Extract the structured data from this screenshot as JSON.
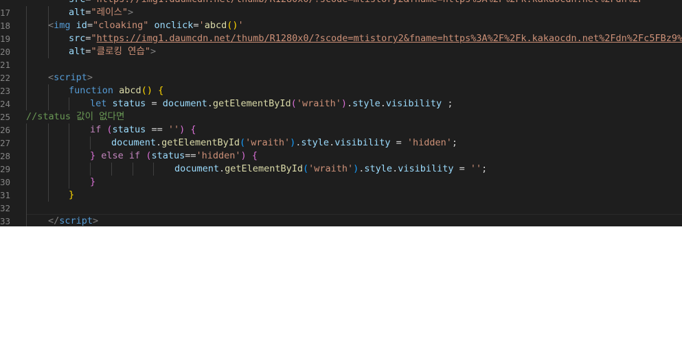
{
  "editor": {
    "lines": [
      {
        "n": "17",
        "parts": [
          {
            "c": "t-attr",
            "t": "alt"
          },
          {
            "c": "t-plain",
            "t": "="
          },
          {
            "c": "t-str",
            "t": "\"레이스\""
          },
          {
            "c": "t-tag",
            "t": ">"
          }
        ]
      },
      {
        "n": "18",
        "parts": [
          {
            "c": "t-tag",
            "t": "<"
          },
          {
            "c": "t-tagname",
            "t": "img"
          },
          {
            "c": "t-plain",
            "t": " "
          },
          {
            "c": "t-attr",
            "t": "id"
          },
          {
            "c": "t-plain",
            "t": "="
          },
          {
            "c": "t-str",
            "t": "\"cloaking\""
          },
          {
            "c": "t-plain",
            "t": " "
          },
          {
            "c": "t-attr",
            "t": "onclick"
          },
          {
            "c": "t-plain",
            "t": "="
          },
          {
            "c": "t-str",
            "t": "'"
          },
          {
            "c": "t-fn",
            "t": "abcd"
          },
          {
            "c": "t-brk1",
            "t": "()"
          },
          {
            "c": "t-str",
            "t": "'"
          }
        ]
      },
      {
        "n": "19",
        "parts": [
          {
            "c": "t-attr",
            "t": "src"
          },
          {
            "c": "t-plain",
            "t": "="
          },
          {
            "c": "t-str",
            "t": "\""
          },
          {
            "c": "t-link",
            "t": "https://img1.daumcdn.net/thumb/R1280x0/?scode=mtistory2&fname=https%3A%2F%2Fk.kakaocdn.net%2Fdn%2Fc5FBz9%2FbtrI"
          }
        ]
      },
      {
        "n": "20",
        "parts": [
          {
            "c": "t-attr",
            "t": "alt"
          },
          {
            "c": "t-plain",
            "t": "="
          },
          {
            "c": "t-str",
            "t": "\"클로킹 연습\""
          },
          {
            "c": "t-tag",
            "t": ">"
          }
        ]
      },
      {
        "n": "21",
        "parts": []
      },
      {
        "n": "22",
        "parts": [
          {
            "c": "t-tag",
            "t": "<"
          },
          {
            "c": "t-tagname",
            "t": "script"
          },
          {
            "c": "t-tag",
            "t": ">"
          }
        ]
      },
      {
        "n": "23",
        "parts": [
          {
            "c": "t-kw",
            "t": "function"
          },
          {
            "c": "t-plain",
            "t": " "
          },
          {
            "c": "t-fn",
            "t": "abcd"
          },
          {
            "c": "t-brk1",
            "t": "()"
          },
          {
            "c": "t-plain",
            "t": " "
          },
          {
            "c": "t-brk1",
            "t": "{"
          }
        ]
      },
      {
        "n": "24",
        "parts": [
          {
            "c": "t-kw",
            "t": "let"
          },
          {
            "c": "t-plain",
            "t": " "
          },
          {
            "c": "t-var",
            "t": "status"
          },
          {
            "c": "t-plain",
            "t": " = "
          },
          {
            "c": "t-var",
            "t": "document"
          },
          {
            "c": "t-plain",
            "t": "."
          },
          {
            "c": "t-fn",
            "t": "getElementById"
          },
          {
            "c": "t-brk2",
            "t": "("
          },
          {
            "c": "t-str",
            "t": "'wraith'"
          },
          {
            "c": "t-brk2",
            "t": ")"
          },
          {
            "c": "t-plain",
            "t": "."
          },
          {
            "c": "t-var",
            "t": "style"
          },
          {
            "c": "t-plain",
            "t": "."
          },
          {
            "c": "t-var",
            "t": "visibility"
          },
          {
            "c": "t-plain",
            "t": " ;"
          }
        ]
      },
      {
        "n": "25",
        "parts": [
          {
            "c": "t-cmt",
            "t": "//status 값이 없다면"
          }
        ]
      },
      {
        "n": "26",
        "parts": [
          {
            "c": "t-ctl",
            "t": "if"
          },
          {
            "c": "t-plain",
            "t": " "
          },
          {
            "c": "t-brk2",
            "t": "("
          },
          {
            "c": "t-var",
            "t": "status"
          },
          {
            "c": "t-plain",
            "t": " == "
          },
          {
            "c": "t-str",
            "t": "''"
          },
          {
            "c": "t-brk2",
            "t": ")"
          },
          {
            "c": "t-plain",
            "t": " "
          },
          {
            "c": "t-brk2",
            "t": "{"
          }
        ]
      },
      {
        "n": "27",
        "parts": [
          {
            "c": "t-var",
            "t": "document"
          },
          {
            "c": "t-plain",
            "t": "."
          },
          {
            "c": "t-fn",
            "t": "getElementById"
          },
          {
            "c": "t-brk3",
            "t": "("
          },
          {
            "c": "t-str",
            "t": "'wraith'"
          },
          {
            "c": "t-brk3",
            "t": ")"
          },
          {
            "c": "t-plain",
            "t": "."
          },
          {
            "c": "t-var",
            "t": "style"
          },
          {
            "c": "t-plain",
            "t": "."
          },
          {
            "c": "t-var",
            "t": "visibility"
          },
          {
            "c": "t-plain",
            "t": " = "
          },
          {
            "c": "t-str",
            "t": "'hidden'"
          },
          {
            "c": "t-plain",
            "t": ";"
          }
        ]
      },
      {
        "n": "28",
        "parts": [
          {
            "c": "t-brk2",
            "t": "}"
          },
          {
            "c": "t-plain",
            "t": " "
          },
          {
            "c": "t-ctl",
            "t": "else if"
          },
          {
            "c": "t-plain",
            "t": " "
          },
          {
            "c": "t-brk2",
            "t": "("
          },
          {
            "c": "t-var",
            "t": "status"
          },
          {
            "c": "t-plain",
            "t": "=="
          },
          {
            "c": "t-str",
            "t": "'hidden'"
          },
          {
            "c": "t-brk2",
            "t": ")"
          },
          {
            "c": "t-plain",
            "t": " "
          },
          {
            "c": "t-brk2",
            "t": "{"
          }
        ]
      },
      {
        "n": "29",
        "parts": [
          {
            "c": "t-var",
            "t": "document"
          },
          {
            "c": "t-plain",
            "t": "."
          },
          {
            "c": "t-fn",
            "t": "getElementById"
          },
          {
            "c": "t-brk3",
            "t": "("
          },
          {
            "c": "t-str",
            "t": "'wraith'"
          },
          {
            "c": "t-brk3",
            "t": ")"
          },
          {
            "c": "t-plain",
            "t": "."
          },
          {
            "c": "t-var",
            "t": "style"
          },
          {
            "c": "t-plain",
            "t": "."
          },
          {
            "c": "t-var",
            "t": "visibility"
          },
          {
            "c": "t-plain",
            "t": " = "
          },
          {
            "c": "t-str",
            "t": "''"
          },
          {
            "c": "t-plain",
            "t": ";"
          }
        ]
      },
      {
        "n": "30",
        "parts": [
          {
            "c": "t-brk2",
            "t": "}"
          }
        ]
      },
      {
        "n": "31",
        "parts": [
          {
            "c": "t-brk1",
            "t": "}"
          }
        ]
      },
      {
        "n": "32",
        "parts": []
      },
      {
        "n": "33",
        "parts": [
          {
            "c": "t-tag",
            "t": "</"
          },
          {
            "c": "t-tagname",
            "t": "script"
          },
          {
            "c": "t-tag",
            "t": ">"
          }
        ]
      }
    ]
  }
}
